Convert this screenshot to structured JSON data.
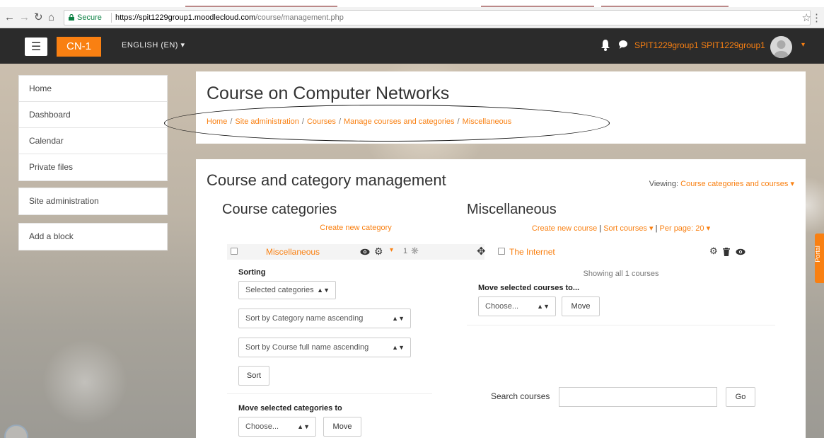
{
  "browser": {
    "secure_label": "Secure",
    "url_host": "https://spit1229group1.moodlecloud.com",
    "url_path": "/course/management.php"
  },
  "navbar": {
    "brand": "CN-1",
    "language": "ENGLISH (EN)",
    "user_name": "SPIT1229group1 SPIT1229group1",
    "accent_color": "#f98012"
  },
  "drawer": {
    "items": [
      "Home",
      "Dashboard",
      "Calendar",
      "Private files"
    ],
    "admin": "Site administration",
    "add_block": "Add a block"
  },
  "header": {
    "title": "Course on Computer Networks",
    "breadcrumb": [
      "Home",
      "Site administration",
      "Courses",
      "Manage courses and categories",
      "Miscellaneous"
    ]
  },
  "management": {
    "title": "Course and category management",
    "viewing_label": "Viewing:",
    "viewing_value": "Course categories and courses",
    "categories": {
      "heading": "Course categories",
      "create_link": "Create new category",
      "row": {
        "name": "Miscellaneous",
        "count": "1"
      },
      "sorting_label": "Sorting",
      "sort_scope": "Selected categories",
      "sort_categories": "Sort by Category name ascending",
      "sort_courses": "Sort by Course full name ascending",
      "sort_button": "Sort",
      "move_label": "Move selected categories to",
      "move_choose": "Choose...",
      "move_button": "Move"
    },
    "courses": {
      "heading": "Miscellaneous",
      "create_link": "Create new course",
      "sort_link": "Sort courses",
      "per_page": "Per page: 20",
      "course_name": "The Internet",
      "showing": "Showing all 1 courses",
      "move_label": "Move selected courses to...",
      "move_choose": "Choose...",
      "move_button": "Move",
      "search_label": "Search courses",
      "search_value": "",
      "go_button": "Go"
    }
  },
  "portal_tab": "Portal"
}
